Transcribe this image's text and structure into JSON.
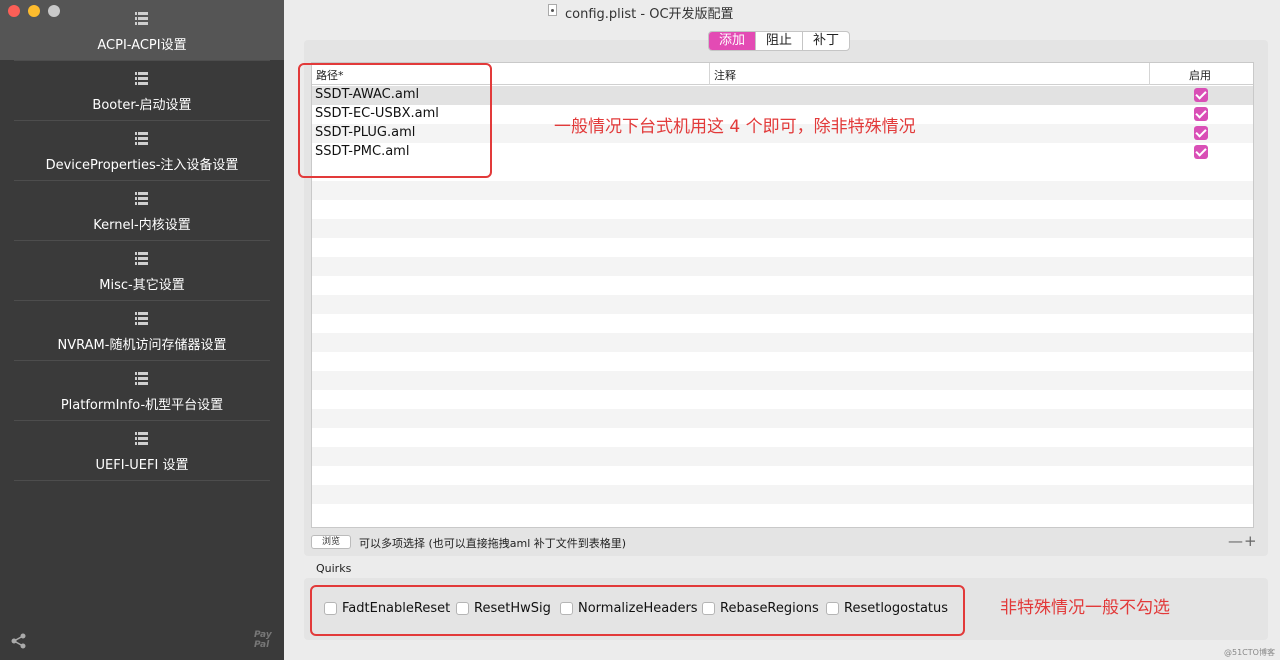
{
  "window": {
    "title": "config.plist - OC开发版配置"
  },
  "sidebar": {
    "items": [
      {
        "label": "ACPI-ACPI设置",
        "active": true
      },
      {
        "label": "Booter-启动设置"
      },
      {
        "label": "DeviceProperties-注入设备设置"
      },
      {
        "label": "Kernel-内核设置"
      },
      {
        "label": "Misc-其它设置"
      },
      {
        "label": "NVRAM-随机访问存储器设置"
      },
      {
        "label": "PlatformInfo-机型平台设置"
      },
      {
        "label": "UEFI-UEFI 设置"
      }
    ],
    "paypal_label": "Pay Pal"
  },
  "tabs": [
    {
      "label": "添加",
      "active": true
    },
    {
      "label": "阻止"
    },
    {
      "label": "补丁"
    }
  ],
  "table": {
    "columns": [
      "路径*",
      "注释",
      "启用"
    ],
    "rows": [
      {
        "path": "SSDT-AWAC.aml",
        "comment": "",
        "enabled": true
      },
      {
        "path": "SSDT-EC-USBX.aml",
        "comment": "",
        "enabled": true
      },
      {
        "path": "SSDT-PLUG.aml",
        "comment": "",
        "enabled": true
      },
      {
        "path": "SSDT-PMC.aml",
        "comment": "",
        "enabled": true
      }
    ]
  },
  "footer": {
    "browse_label": "浏览",
    "hint": "可以多项选择 (也可以直接拖拽aml 补丁文件到表格里)",
    "minus_plus": "—+"
  },
  "quirks": {
    "label": "Quirks",
    "items": [
      {
        "label": "FadtEnableReset",
        "checked": false
      },
      {
        "label": "ResetHwSig",
        "checked": false
      },
      {
        "label": "NormalizeHeaders",
        "checked": false
      },
      {
        "label": "RebaseRegions",
        "checked": false
      },
      {
        "label": "Resetlogostatus",
        "checked": false
      }
    ]
  },
  "annotations": {
    "table_note": "一般情况下台式机用这 4 个即可，除非特殊情况",
    "quirks_note": "非特殊情况一般不勾选",
    "color": "#e23a3a"
  },
  "watermark": "@51CTO博客",
  "colors": {
    "accent": "#e34bb4",
    "sidebar_bg": "#3a3a3a"
  }
}
